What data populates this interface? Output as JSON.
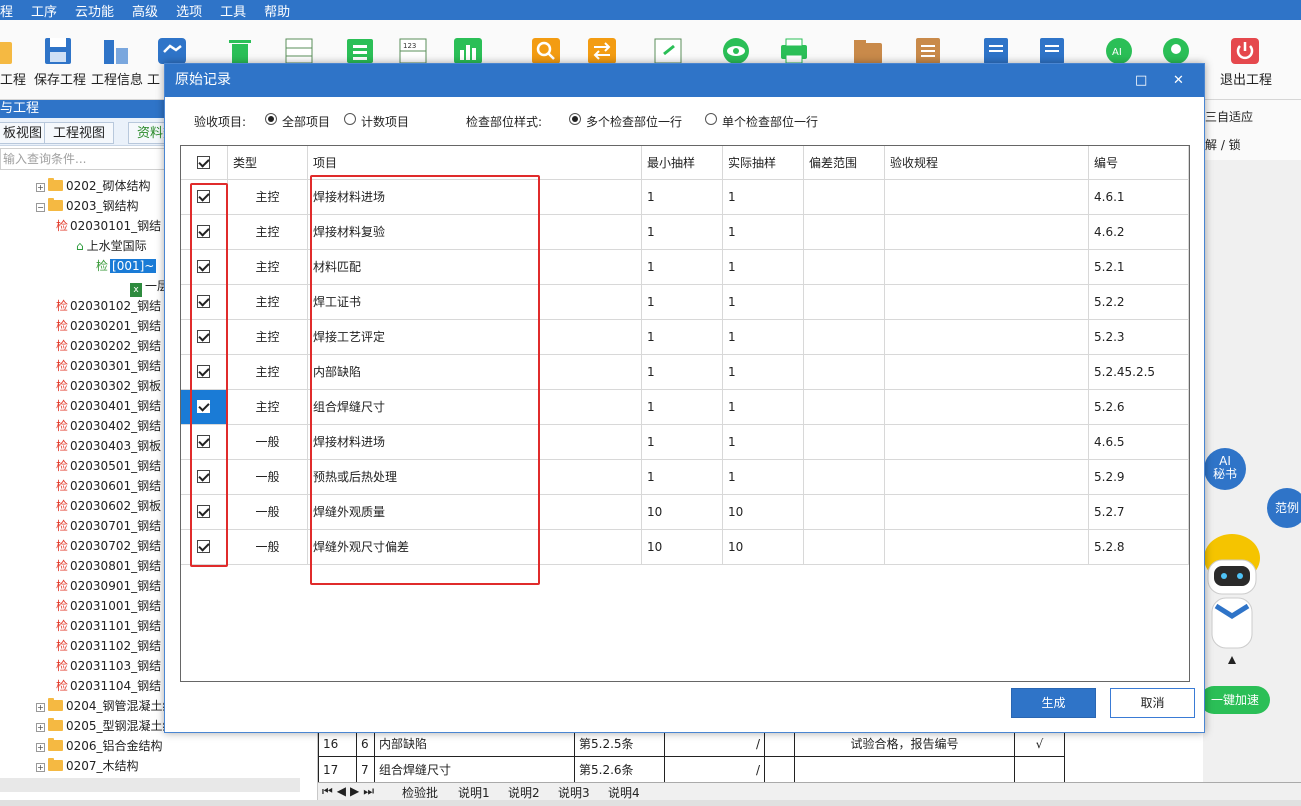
{
  "menubar": [
    "程",
    "工序",
    "云功能",
    "高级",
    "选项",
    "工具",
    "帮助"
  ],
  "toolbar": {
    "labels": [
      "工程",
      "保存工程",
      "工程信息",
      "工",
      "退出工程"
    ],
    "colors": {
      "primary": "#2f74c8",
      "green": "#2bbf57",
      "red": "#e5484d",
      "orange": "#f39c12"
    }
  },
  "left_panel": {
    "header": "与工程",
    "tabs": [
      "板视图",
      "工程视图",
      "资料数"
    ],
    "search_placeholder": "输入查询条件...",
    "tree": [
      {
        "label": "0202_砌体结构",
        "kind": "folder"
      },
      {
        "label": "0203_钢结构",
        "kind": "folder"
      },
      {
        "label": "02030101_钢结",
        "kind": "jian"
      },
      {
        "label": "上水堂国际",
        "kind": "home"
      },
      {
        "label": "[001]~",
        "kind": "sel"
      },
      {
        "label": "一层",
        "kind": "xls"
      },
      {
        "label": "02030102_钢结",
        "kind": "jian"
      },
      {
        "label": "02030201_钢结",
        "kind": "jian"
      },
      {
        "label": "02030202_钢结",
        "kind": "jian"
      },
      {
        "label": "02030301_钢结",
        "kind": "jian"
      },
      {
        "label": "02030302_钢板",
        "kind": "jian"
      },
      {
        "label": "02030401_钢结",
        "kind": "jian"
      },
      {
        "label": "02030402_钢结",
        "kind": "jian"
      },
      {
        "label": "02030403_钢板",
        "kind": "jian"
      },
      {
        "label": "02030501_钢结",
        "kind": "jian"
      },
      {
        "label": "02030601_钢结",
        "kind": "jian"
      },
      {
        "label": "02030602_钢板",
        "kind": "jian"
      },
      {
        "label": "02030701_钢结",
        "kind": "jian"
      },
      {
        "label": "02030702_钢结",
        "kind": "jian"
      },
      {
        "label": "02030801_钢结",
        "kind": "jian"
      },
      {
        "label": "02030901_钢结",
        "kind": "jian"
      },
      {
        "label": "02031001_钢结",
        "kind": "jian"
      },
      {
        "label": "02031101_钢结",
        "kind": "jian"
      },
      {
        "label": "02031102_钢结",
        "kind": "jian"
      },
      {
        "label": "02031103_钢结",
        "kind": "jian"
      },
      {
        "label": "02031104_钢结",
        "kind": "jian"
      },
      {
        "label": "0204_钢管混凝土结",
        "kind": "folder"
      },
      {
        "label": "0205_型钢混凝土结构",
        "kind": "folder"
      },
      {
        "label": "0206_铝合金结构",
        "kind": "folder"
      },
      {
        "label": "0207_木结构",
        "kind": "folder"
      }
    ]
  },
  "right_panel": {
    "fit_label": "三自适应",
    "lock_label": "解 / 锁",
    "ai_label": [
      "AI",
      "秘书"
    ],
    "example_label": "范例",
    "speed_label": "一键加速"
  },
  "sheet": {
    "rows": [
      [
        "16",
        "6",
        "内部缺陷",
        "第5.2.5条",
        "/",
        "",
        "试验合格，报告编号",
        "√"
      ],
      [
        "17",
        "7",
        "组合焊缝尺寸",
        "第5.2.6条",
        "/",
        "",
        "",
        ""
      ]
    ],
    "tabs": [
      "检验批",
      "说明1",
      "说明2",
      "说明3",
      "说明4"
    ]
  },
  "dialog": {
    "title": "原始记录",
    "filters": {
      "acceptance_label": "验收项目:",
      "acceptance_options": [
        "全部项目",
        "计数项目"
      ],
      "acceptance_selected": "全部项目",
      "style_label": "检查部位样式:",
      "style_options": [
        "多个检查部位一行",
        "单个检查部位一行"
      ],
      "style_selected": "多个检查部位一行"
    },
    "columns": [
      "类型",
      "项目",
      "最小抽样",
      "实际抽样",
      "偏差范围",
      "验收规程",
      "编号"
    ],
    "rows": [
      {
        "checked": true,
        "type": "主控",
        "item": "焊接材料进场",
        "min": "1",
        "actual": "1",
        "dev": "",
        "rule": "",
        "code": "4.6.1",
        "selected": false
      },
      {
        "checked": true,
        "type": "主控",
        "item": "焊接材料复验",
        "min": "1",
        "actual": "1",
        "dev": "",
        "rule": "",
        "code": "4.6.2",
        "selected": false
      },
      {
        "checked": true,
        "type": "主控",
        "item": "材料匹配",
        "min": "1",
        "actual": "1",
        "dev": "",
        "rule": "",
        "code": "5.2.1",
        "selected": false
      },
      {
        "checked": true,
        "type": "主控",
        "item": "焊工证书",
        "min": "1",
        "actual": "1",
        "dev": "",
        "rule": "",
        "code": "5.2.2",
        "selected": false
      },
      {
        "checked": true,
        "type": "主控",
        "item": "焊接工艺评定",
        "min": "1",
        "actual": "1",
        "dev": "",
        "rule": "",
        "code": "5.2.3",
        "selected": false
      },
      {
        "checked": true,
        "type": "主控",
        "item": "内部缺陷",
        "min": "1",
        "actual": "1",
        "dev": "",
        "rule": "",
        "code": "5.2.45.2.5",
        "selected": false
      },
      {
        "checked": true,
        "type": "主控",
        "item": "组合焊缝尺寸",
        "min": "1",
        "actual": "1",
        "dev": "",
        "rule": "",
        "code": "5.2.6",
        "selected": true
      },
      {
        "checked": true,
        "type": "一般",
        "item": "焊接材料进场",
        "min": "1",
        "actual": "1",
        "dev": "",
        "rule": "",
        "code": "4.6.5",
        "selected": false
      },
      {
        "checked": true,
        "type": "一般",
        "item": "预热或后热处理",
        "min": "1",
        "actual": "1",
        "dev": "",
        "rule": "",
        "code": "5.2.9",
        "selected": false
      },
      {
        "checked": true,
        "type": "一般",
        "item": "焊缝外观质量",
        "min": "10",
        "actual": "10",
        "dev": "",
        "rule": "",
        "code": "5.2.7",
        "selected": false
      },
      {
        "checked": true,
        "type": "一般",
        "item": "焊缝外观尺寸偏差",
        "min": "10",
        "actual": "10",
        "dev": "",
        "rule": "",
        "code": "5.2.8",
        "selected": false
      }
    ],
    "generate_label": "生成",
    "cancel_label": "取消",
    "highlight_color": "#e02b2b"
  }
}
